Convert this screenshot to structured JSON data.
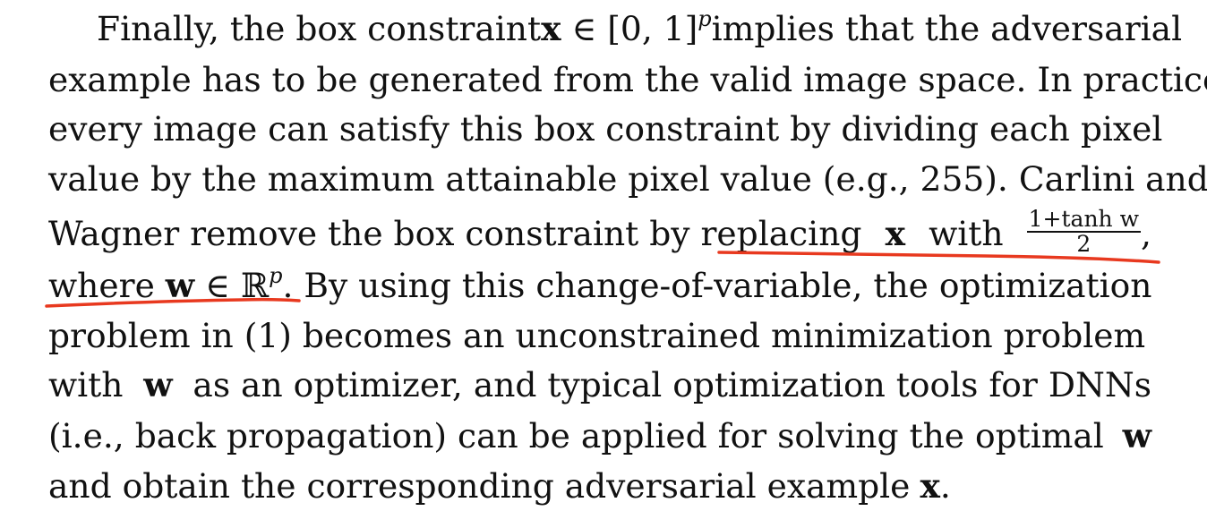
{
  "paragraph": {
    "line1": {
      "t1": "Finally, the box constraint",
      "x": "x",
      "in": "∈",
      "range": "[0, 1]",
      "p": "p",
      "t2": "implies that the adversarial"
    },
    "line2": "example has to be generated from the valid image space. In practice,",
    "line3": "every image can satisfy this box constraint by dividing each pixel",
    "line4": "value by the maximum attainable pixel value (e.g., 255). Carlini and",
    "line5": {
      "t1": "Wagner remove the box constraint by replacing",
      "x": "x",
      "t2": "with",
      "numerator": "1+tanh w",
      "denominator": "2",
      "t3": ","
    },
    "line6": {
      "t1": "where",
      "w": "w",
      "in": "∈",
      "R": "ℝ",
      "p": "p",
      "t2": ". By using this change-of-variable, the optimization"
    },
    "line7": "problem in (1) becomes an unconstrained minimization problem",
    "line8": {
      "t1": "with",
      "w": "w",
      "t2": "as an optimizer, and typical optimization tools for DNNs"
    },
    "line9": {
      "t1": "(i.e., back propagation) can be applied for solving the optimal",
      "w": "w"
    },
    "line10": {
      "t1": "and obtain the corresponding adversarial example",
      "x": "x",
      "t2": "."
    }
  },
  "annotation_color": "#e8391f"
}
